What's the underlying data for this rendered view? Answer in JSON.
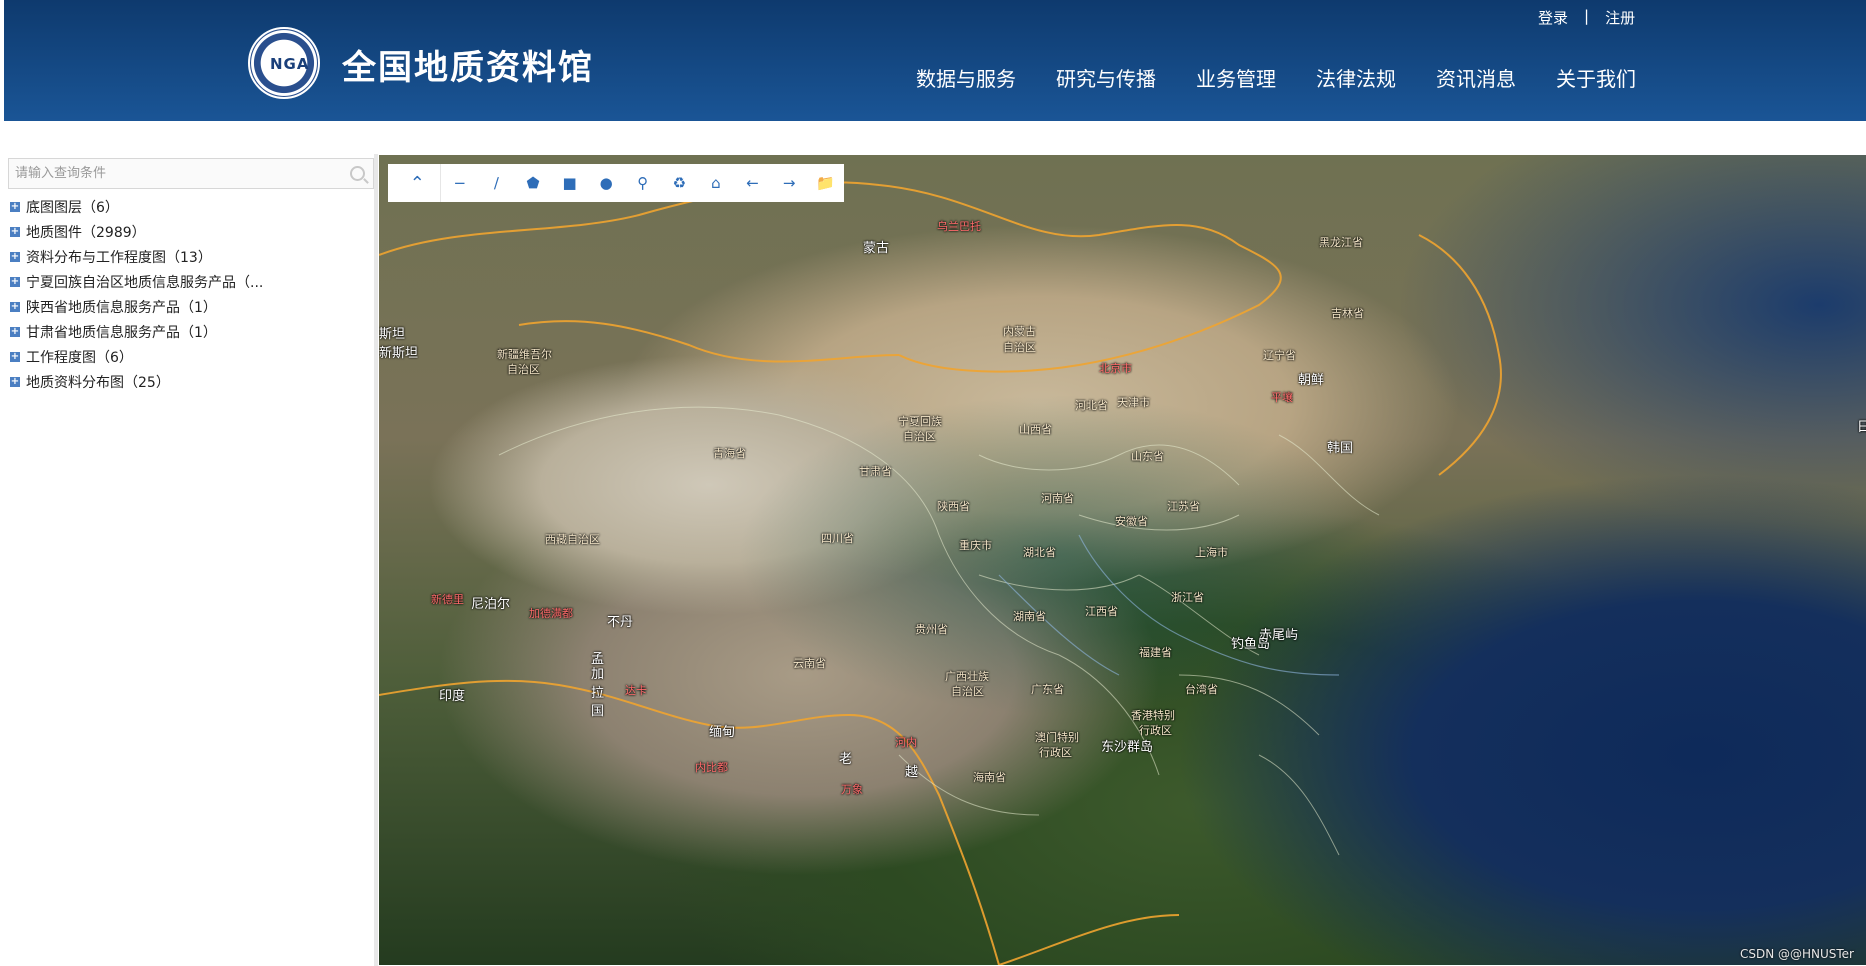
{
  "header": {
    "logo_text": "NGA",
    "title": "全国地质资料馆",
    "top_links": [
      "登录",
      "|",
      "注册"
    ],
    "nav": [
      "数据与服务",
      "研究与传播",
      "业务管理",
      "法律法规",
      "资讯消息",
      "关于我们"
    ]
  },
  "sidebar": {
    "search_placeholder": "请输入查询条件",
    "items": [
      {
        "label": "底图图层（6）"
      },
      {
        "label": "地质图件（2989）"
      },
      {
        "label": "资料分布与工作程度图（13）"
      },
      {
        "label": "宁夏回族自治区地质信息服务产品（..."
      },
      {
        "label": "陕西省地质信息服务产品（1）"
      },
      {
        "label": "甘肃省地质信息服务产品（1）"
      },
      {
        "label": "工作程度图（6）"
      },
      {
        "label": "地质资料分布图（25）"
      }
    ]
  },
  "toolbar": {
    "icons": [
      "collapse-up",
      "line-minus",
      "draw-line",
      "draw-polygon",
      "draw-rectangle",
      "draw-circle",
      "place-marker",
      "delete",
      "home",
      "back",
      "forward",
      "open-folder"
    ]
  },
  "map": {
    "labels": [
      {
        "text": "乌兰巴托",
        "kind": "capital"
      },
      {
        "text": "蒙古",
        "kind": "country"
      },
      {
        "text": "黑龙江省",
        "kind": "province"
      },
      {
        "text": "吉林省",
        "kind": "province"
      },
      {
        "text": "内蒙古",
        "kind": "province"
      },
      {
        "text": "自治区",
        "kind": "province"
      },
      {
        "text": "新疆维吾尔",
        "kind": "province"
      },
      {
        "text": "自治区",
        "kind": "province"
      },
      {
        "text": "北京市",
        "kind": "capital"
      },
      {
        "text": "辽宁省",
        "kind": "province"
      },
      {
        "text": "平壤",
        "kind": "capital"
      },
      {
        "text": "朝鲜",
        "kind": "country"
      },
      {
        "text": "河北省",
        "kind": "province"
      },
      {
        "text": "天津市",
        "kind": "province"
      },
      {
        "text": "宁夏回族",
        "kind": "province"
      },
      {
        "text": "自治区",
        "kind": "province"
      },
      {
        "text": "山西省",
        "kind": "province"
      },
      {
        "text": "青海省",
        "kind": "province"
      },
      {
        "text": "甘肃省",
        "kind": "province"
      },
      {
        "text": "山东省",
        "kind": "province"
      },
      {
        "text": "韩国",
        "kind": "country"
      },
      {
        "text": "河南省",
        "kind": "province"
      },
      {
        "text": "陕西省",
        "kind": "province"
      },
      {
        "text": "江苏省",
        "kind": "province"
      },
      {
        "text": "安徽省",
        "kind": "province"
      },
      {
        "text": "西藏自治区",
        "kind": "province"
      },
      {
        "text": "四川省",
        "kind": "province"
      },
      {
        "text": "重庆市",
        "kind": "province"
      },
      {
        "text": "湖北省",
        "kind": "province"
      },
      {
        "text": "上海市",
        "kind": "province"
      },
      {
        "text": "新德里",
        "kind": "capital"
      },
      {
        "text": "尼泊尔",
        "kind": "country"
      },
      {
        "text": "加德满都",
        "kind": "capital"
      },
      {
        "text": "不丹",
        "kind": "country"
      },
      {
        "text": "浙江省",
        "kind": "province"
      },
      {
        "text": "江西省",
        "kind": "province"
      },
      {
        "text": "湖南省",
        "kind": "province"
      },
      {
        "text": "贵州省",
        "kind": "province"
      },
      {
        "text": "赤尾屿",
        "kind": "country"
      },
      {
        "text": "钓鱼岛",
        "kind": "country"
      },
      {
        "text": "福建省",
        "kind": "province"
      },
      {
        "text": "孟",
        "kind": "country"
      },
      {
        "text": "加",
        "kind": "country"
      },
      {
        "text": "拉",
        "kind": "country"
      },
      {
        "text": "国",
        "kind": "country"
      },
      {
        "text": "达卡",
        "kind": "capital"
      },
      {
        "text": "云南省",
        "kind": "province"
      },
      {
        "text": "广西壮族",
        "kind": "province"
      },
      {
        "text": "自治区",
        "kind": "province"
      },
      {
        "text": "广东省",
        "kind": "province"
      },
      {
        "text": "台湾省",
        "kind": "province"
      },
      {
        "text": "印度",
        "kind": "country"
      },
      {
        "text": "香港特别",
        "kind": "province"
      },
      {
        "text": "行政区",
        "kind": "province"
      },
      {
        "text": "缅甸",
        "kind": "country"
      },
      {
        "text": "澳门特别",
        "kind": "province"
      },
      {
        "text": "行政区",
        "kind": "province"
      },
      {
        "text": "东沙群岛",
        "kind": "country"
      },
      {
        "text": "河内",
        "kind": "capital"
      },
      {
        "text": "老",
        "kind": "country"
      },
      {
        "text": "内比都",
        "kind": "capital"
      },
      {
        "text": "越",
        "kind": "country"
      },
      {
        "text": "海南省",
        "kind": "province"
      },
      {
        "text": "万象",
        "kind": "capital"
      },
      {
        "text": "斯坦",
        "kind": "country"
      },
      {
        "text": "新斯坦",
        "kind": "country"
      },
      {
        "text": "日",
        "kind": "country"
      }
    ]
  },
  "watermark": "CSDN @@HNUSTer"
}
